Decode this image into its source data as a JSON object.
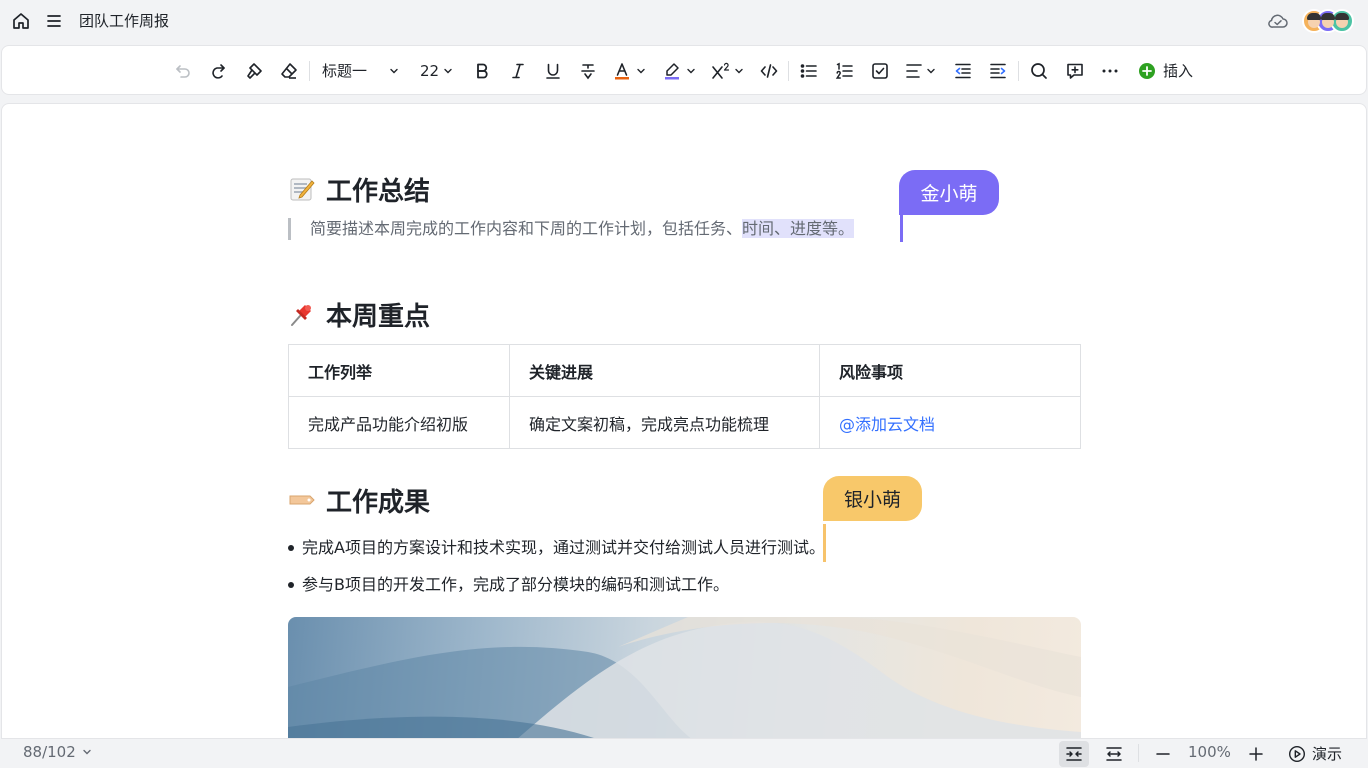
{
  "topbar": {
    "title": "团队工作周报",
    "icons": [
      "home-icon",
      "menu-icon",
      "cloud-check-icon"
    ],
    "avatar_colors": [
      "#f5b25b",
      "#7b6cf5",
      "#4cc3a4"
    ]
  },
  "toolbar": {
    "heading_style": "标题一",
    "font_size": "22",
    "insert_label": "插入",
    "icons": [
      "undo-icon",
      "redo-icon",
      "format-painter-icon",
      "eraser-icon",
      "bold-icon",
      "italic-icon",
      "underline-icon",
      "strikethrough-icon",
      "font-color-icon",
      "highlight-icon",
      "superscript-icon",
      "code-icon",
      "bullet-list-icon",
      "numbered-list-icon",
      "checkbox-icon",
      "align-icon",
      "outdent-icon",
      "indent-icon",
      "search-icon",
      "comment-icon",
      "more-icon",
      "plus-circle-icon"
    ],
    "accent_insert": "#2ea121",
    "font_color_bar": "#e8620f",
    "highlight_bar": "#7b6cf5"
  },
  "doc": {
    "section1": {
      "emoji": "memo-icon",
      "title": "工作总结",
      "quote_plain": "简要描述本周完成的工作内容和下周的工作计划，包括任务、",
      "quote_highlight": "时间、进度等。"
    },
    "collaborators": [
      {
        "name": "金小萌",
        "color": "#7b6cf5"
      },
      {
        "name": "银小萌",
        "color": "#f8c86a"
      }
    ],
    "section2": {
      "emoji": "pushpin-icon",
      "title": "本周重点",
      "table": {
        "headers": [
          "工作列举",
          "关键进展",
          "风险事项"
        ],
        "rows": [
          [
            "完成产品功能介绍初版",
            "确定文案初稿，完成亮点功能梳理",
            "@添加云文档"
          ]
        ]
      }
    },
    "section3": {
      "emoji": "tag-icon",
      "title": "工作成果",
      "bullets": [
        "完成A项目的方案设计和技术实现，通过测试并交付给测试人员进行测试。",
        "参与B项目的开发工作，完成了部分模块的编码和测试工作。"
      ]
    }
  },
  "statusbar": {
    "page_count": "88/102",
    "zoom": "100%",
    "present_label": "演示"
  }
}
